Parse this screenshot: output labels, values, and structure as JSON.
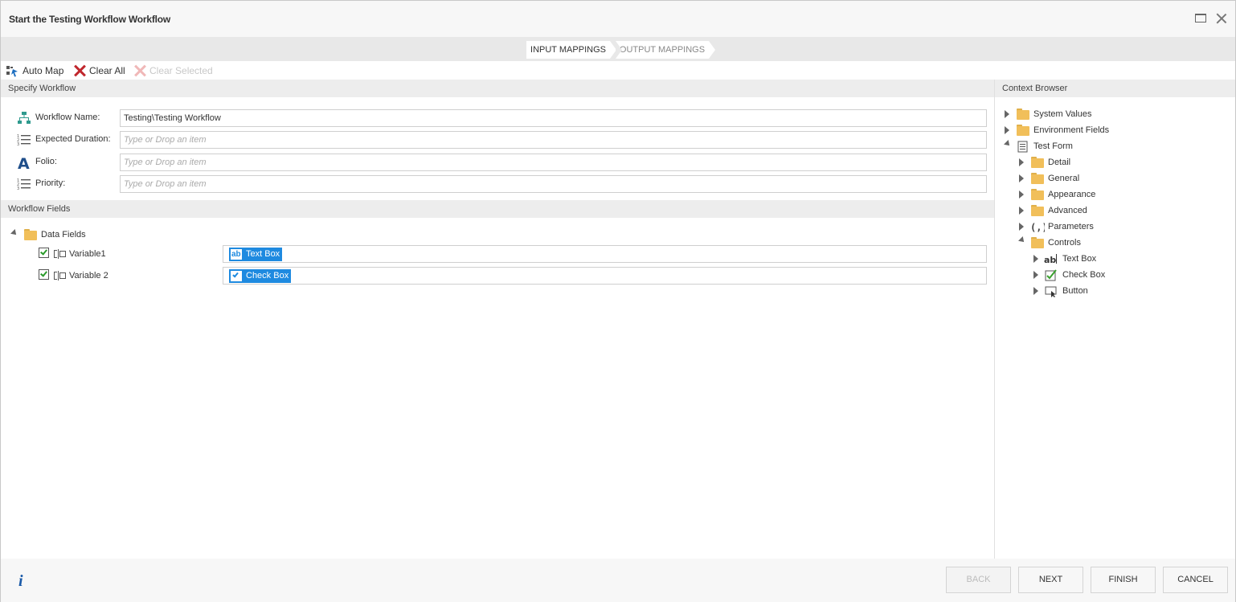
{
  "window": {
    "title": "Start the Testing Workflow Workflow"
  },
  "steps": {
    "input": "INPUT MAPPINGS",
    "output": "OUTPUT MAPPINGS"
  },
  "toolbar": {
    "auto_map": "Auto Map",
    "clear_all": "Clear All",
    "clear_selected": "Clear Selected"
  },
  "specify": {
    "header": "Specify Workflow",
    "fields": [
      {
        "label": "Workflow Name:",
        "value": "Testing\\Testing Workflow",
        "placeholder": ""
      },
      {
        "label": "Expected Duration:",
        "value": "",
        "placeholder": "Type or Drop an item"
      },
      {
        "label": "Folio:",
        "value": "",
        "placeholder": "Type or Drop an item"
      },
      {
        "label": "Priority:",
        "value": "",
        "placeholder": "Type or Drop an item"
      }
    ]
  },
  "workflow_fields": {
    "header": "Workflow Fields",
    "root": "Data Fields",
    "variables": [
      {
        "name": "Variable1",
        "checked": true,
        "mapping": "Text Box",
        "mapping_icon": "textbox-icon"
      },
      {
        "name": "Variable 2",
        "checked": true,
        "mapping": "Check Box",
        "mapping_icon": "checkbox-icon"
      }
    ]
  },
  "context_browser": {
    "header": "Context Browser",
    "items": [
      {
        "label": "System Values",
        "icon": "folder-icon"
      },
      {
        "label": "Environment Fields",
        "icon": "folder-icon"
      },
      {
        "label": "Test Form",
        "icon": "form-icon"
      },
      {
        "label": "Detail",
        "icon": "folder-icon"
      },
      {
        "label": "General",
        "icon": "folder-icon"
      },
      {
        "label": "Appearance",
        "icon": "folder-icon"
      },
      {
        "label": "Advanced",
        "icon": "folder-icon"
      },
      {
        "label": "Parameters",
        "icon": "parameters-icon"
      },
      {
        "label": "Controls",
        "icon": "folder-icon"
      },
      {
        "label": "Text Box",
        "icon": "textbox-icon"
      },
      {
        "label": "Check Box",
        "icon": "checkbox-icon"
      },
      {
        "label": "Button",
        "icon": "button-icon"
      }
    ]
  },
  "footer": {
    "back": "BACK",
    "next": "NEXT",
    "finish": "FINISH",
    "cancel": "CANCEL"
  },
  "colors": {
    "accent": "#1e8ae0",
    "folder": "#f1bf5a",
    "clear_red": "#c0272d"
  }
}
